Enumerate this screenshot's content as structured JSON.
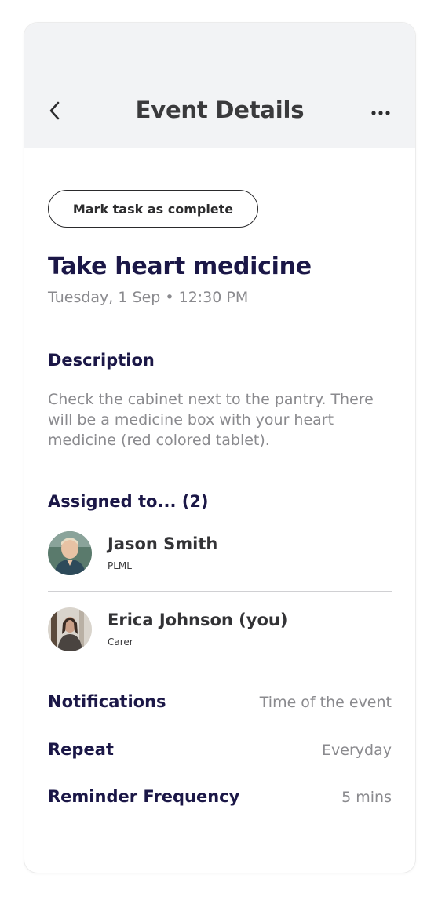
{
  "header": {
    "title": "Event Details",
    "back_icon": "chevron-left-icon",
    "more_icon": "more-horizontal-icon"
  },
  "actions": {
    "complete_label": "Mark task as complete"
  },
  "task": {
    "title": "Take heart medicine",
    "datetime": "Tuesday, 1 Sep • 12:30 PM"
  },
  "description": {
    "heading": "Description",
    "text": "Check the cabinet next to the pantry. There will be a medicine box with your heart medicine (red colored tablet)."
  },
  "assigned": {
    "heading": "Assigned to... (2)",
    "people": [
      {
        "name": "Jason Smith",
        "role": "PLML"
      },
      {
        "name": "Erica Johnson (you)",
        "role": "Carer"
      }
    ]
  },
  "settings": [
    {
      "label": "Notifications",
      "value": "Time of the event"
    },
    {
      "label": "Repeat",
      "value": "Everyday"
    },
    {
      "label": "Reminder Frequency",
      "value": "5 mins"
    }
  ],
  "colors": {
    "heading": "#1b1747",
    "header_bg": "#f2f3f5",
    "muted_text": "#8a8a8e"
  }
}
